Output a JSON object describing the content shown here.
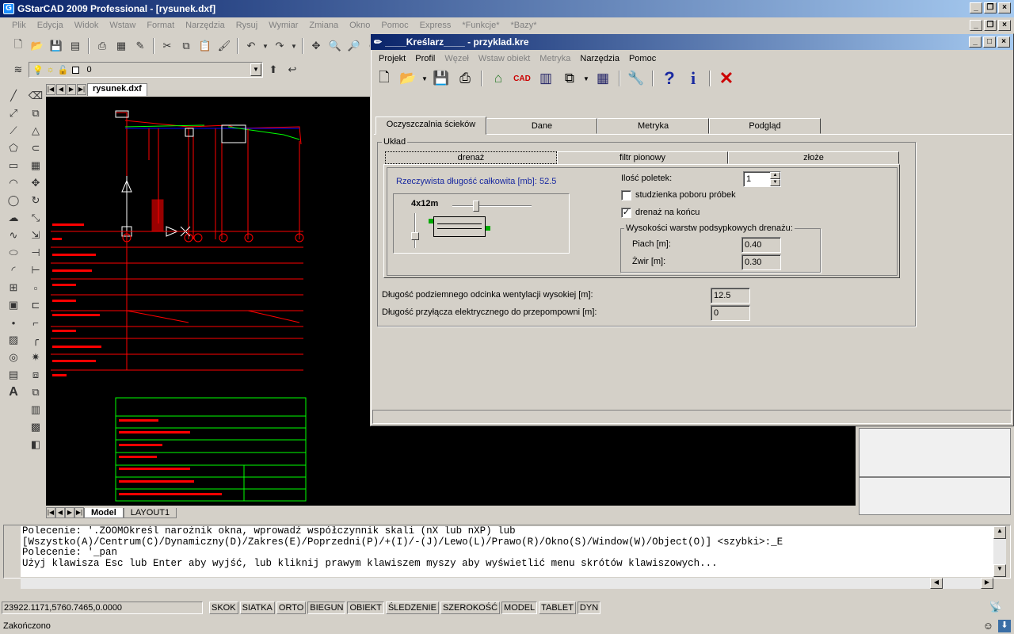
{
  "app": {
    "title": "GStarCAD 2009 Professional - [rysunek.dxf]",
    "menu": [
      "Plik",
      "Edycja",
      "Widok",
      "Wstaw",
      "Format",
      "Narzędzia",
      "Rysuj",
      "Wymiar",
      "Zmiana",
      "Okno",
      "Pomoc",
      "Express",
      "*Funkcje*",
      "*Bazy*"
    ]
  },
  "layer": {
    "value": "0"
  },
  "doc_tab": {
    "label": "rysunek.dxf"
  },
  "layout_tabs": {
    "model": "Model",
    "layout1": "LAYOUT1"
  },
  "command": {
    "lines": [
      "Polecenie: '.ZOOMOkreśl narożnik okna, wprowadź współczynnik skali (nX lub nXP) lub",
      "[Wszystko(A)/Centrum(C)/Dynamiczny(D)/Zakres(E)/Poprzedni(P)/+(I)/-(J)/Lewo(L)/Prawo(R)/Okno(S)/Window(W)/Object(O)] <szybki>:_E",
      "Polecenie: '_pan",
      "Użyj klawisza Esc lub Enter aby wyjść, lub kliknij prawym klawiszem myszy aby wyświetlić menu skrótów klawiszowych..."
    ]
  },
  "status": {
    "coords": "23922.1171,5760.7465,0.0000",
    "buttons": [
      {
        "label": "SKOK",
        "on": false
      },
      {
        "label": "SIATKA",
        "on": false
      },
      {
        "label": "ORTO",
        "on": false
      },
      {
        "label": "BIEGUN",
        "on": true
      },
      {
        "label": "OBIEKT",
        "on": true
      },
      {
        "label": "ŚLEDZENIE",
        "on": false
      },
      {
        "label": "SZEROKOŚĆ",
        "on": false
      },
      {
        "label": "MODEL",
        "on": true
      },
      {
        "label": "TABLET",
        "on": false
      },
      {
        "label": "DYN",
        "on": true
      }
    ],
    "bottom": "Zakończono"
  },
  "dialog": {
    "title": "____Kreślarz____ - przyklad.kre",
    "menu": [
      {
        "label": "Projekt",
        "enabled": true
      },
      {
        "label": "Profil",
        "enabled": true
      },
      {
        "label": "Węzeł",
        "enabled": false
      },
      {
        "label": "Wstaw obiekt",
        "enabled": false
      },
      {
        "label": "Metryka",
        "enabled": false
      },
      {
        "label": "Narzędzia",
        "enabled": true
      },
      {
        "label": "Pomoc",
        "enabled": true
      }
    ],
    "tabs": [
      "Oczyszczalnia ścieków",
      "Dane",
      "Metryka",
      "Podgląd"
    ],
    "group_title": "Układ",
    "subtabs": [
      "drenaż",
      "filtr pionowy",
      "złoże"
    ],
    "length_label": "Rzeczywista długość całkowita [mb]: 52.5",
    "layout_label": "4x12m",
    "count_label": "Ilość poletek:",
    "count_value": "1",
    "chk_sample": "studzienka poboru próbek",
    "chk_sample_checked": false,
    "chk_drain_end": "drenaż na końcu",
    "chk_drain_end_checked": true,
    "heights_group": "Wysokości warstw podsypkowych drenażu:",
    "sand_label": "Piach [m]:",
    "sand_value": "0.40",
    "gravel_label": "Żwir [m]:",
    "gravel_value": "0.30",
    "vent_label": "Długość podziemnego odcinka wentylacji wysokiej [m]:",
    "vent_value": "12.5",
    "elec_label": "Długość przyłącza elektrycznego do przepompowni [m]:",
    "elec_value": "0"
  },
  "colors": {
    "title_start": "#0a246a",
    "title_end": "#a6caf0",
    "drawing_red": "#ff0000",
    "drawing_green": "#00ff00",
    "window_bg": "#d4d0c8"
  }
}
